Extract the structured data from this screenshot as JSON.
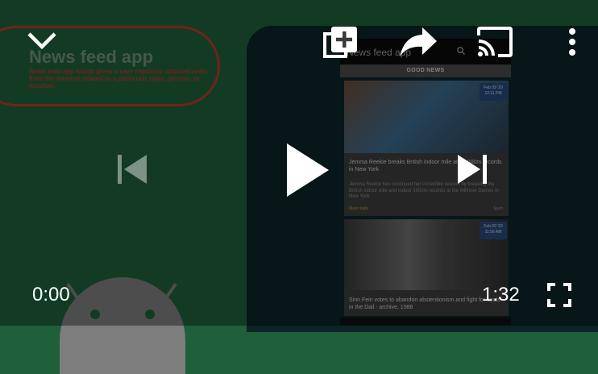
{
  "slide": {
    "title": "News feed app",
    "description": "News feed app which gives a user regularly updated news from the internet related to a particular topic, person, or location."
  },
  "phone": {
    "app_title": "News feed app",
    "section_label": "GOOD NEWS",
    "card1": {
      "badge": "Feb 09 '20 12:11 PM",
      "title": "Jemma Reekie breaks British indoor mile and 1000m records in New York",
      "body": "Jemma Reekie has continued her incredible season by breaking the British indoor mile and indoor 1000m records at the Millrose Games in New York",
      "source": "Mark Inglis",
      "category": "Sport"
    },
    "card2": {
      "badge": "Feb 09 '20 11:56 AM",
      "title": "Sinn Fein votes to abandon abstentionism and fight for seats in the Dail - archive, 1986"
    }
  },
  "player": {
    "current_time": "0:00",
    "duration": "1:32"
  },
  "icons": {
    "collapse": "chevron-down-icon",
    "add_to_playlist": "playlist-add-icon",
    "share": "share-icon",
    "cast": "cast-icon",
    "more": "more-vert-icon",
    "previous": "skip-previous-icon",
    "play": "play-icon",
    "next": "skip-next-icon",
    "fullscreen": "fullscreen-icon"
  }
}
